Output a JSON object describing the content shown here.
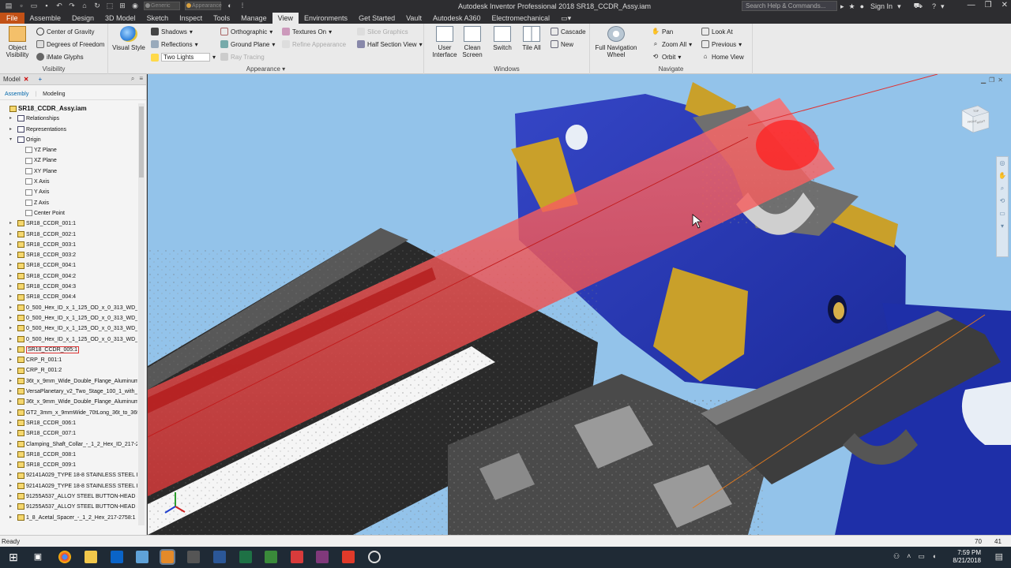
{
  "window": {
    "title": "Autodesk Inventor Professional 2018    SR18_CCDR_Assy.iam",
    "help_search_placeholder": "Search Help & Commands...",
    "sign_in": "Sign In",
    "quick_access_select_1": "Generic",
    "quick_access_select_2": "Appearance"
  },
  "ribbon_tabs": [
    "File",
    "Assemble",
    "Design",
    "3D Model",
    "Sketch",
    "Inspect",
    "Tools",
    "Manage",
    "View",
    "Environments",
    "Get Started",
    "Vault",
    "Autodesk A360",
    "Electromechanical"
  ],
  "active_tab": "View",
  "ribbon": {
    "visibility": {
      "title": "Visibility",
      "object_visibility": "Object Visibility",
      "center_of_gravity": "Center of Gravity",
      "degrees_of_freedom": "Degrees of Freedom",
      "imate_glyphs": "iMate Glyphs"
    },
    "appearance": {
      "title": "Appearance",
      "visual_style": "Visual Style",
      "shadows": "Shadows",
      "reflections": "Reflections",
      "lighting": "Two Lights",
      "orthographic": "Orthographic",
      "ground_plane": "Ground Plane",
      "ray_tracing": "Ray Tracing",
      "textures_on": "Textures On",
      "refine_appearance": "Refine Appearance",
      "slice_graphics": "Slice Graphics",
      "half_section_view": "Half Section View"
    },
    "windows": {
      "title": "Windows",
      "user_interface": "User Interface",
      "clean_screen": "Clean Screen",
      "switch": "Switch",
      "tile_all": "Tile All",
      "cascade": "Cascade",
      "new": "New"
    },
    "navigate": {
      "title": "Navigate",
      "full_navigation_wheel": "Full Navigation Wheel",
      "pan": "Pan",
      "zoom_all": "Zoom All",
      "orbit": "Orbit",
      "look_at": "Look At",
      "previous": "Previous",
      "home_view": "Home View"
    }
  },
  "browser": {
    "tab_label": "Model",
    "sub_tabs": [
      "Assembly",
      "Modeling"
    ],
    "tree": [
      {
        "label": "SR18_CCDR_Assy.iam",
        "level": 0,
        "icon": "assembly",
        "root": true
      },
      {
        "label": "Relationships",
        "level": 1,
        "icon": "folder",
        "expand": "+"
      },
      {
        "label": "Representations",
        "level": 1,
        "icon": "folder",
        "expand": "+"
      },
      {
        "label": "Origin",
        "level": 1,
        "icon": "folder",
        "expand": "-"
      },
      {
        "label": "YZ Plane",
        "level": 2,
        "icon": "plane"
      },
      {
        "label": "XZ Plane",
        "level": 2,
        "icon": "plane"
      },
      {
        "label": "XY Plane",
        "level": 2,
        "icon": "plane"
      },
      {
        "label": "X Axis",
        "level": 2,
        "icon": "axis"
      },
      {
        "label": "Y Axis",
        "level": 2,
        "icon": "axis"
      },
      {
        "label": "Z Axis",
        "level": 2,
        "icon": "axis"
      },
      {
        "label": "Center Point",
        "level": 2,
        "icon": "point"
      },
      {
        "label": "SR18_CCDR_001:1",
        "level": 1,
        "icon": "part",
        "expand": "+"
      },
      {
        "label": "SR18_CCDR_002:1",
        "level": 1,
        "icon": "part",
        "expand": "+"
      },
      {
        "label": "SR18_CCDR_003:1",
        "level": 1,
        "icon": "part",
        "expand": "+"
      },
      {
        "label": "SR18_CCDR_003:2",
        "level": 1,
        "icon": "part",
        "expand": "+"
      },
      {
        "label": "SR18_CCDR_004:1",
        "level": 1,
        "icon": "assembly",
        "expand": "+"
      },
      {
        "label": "SR18_CCDR_004:2",
        "level": 1,
        "icon": "assembly",
        "expand": "+"
      },
      {
        "label": "SR18_CCDR_004:3",
        "level": 1,
        "icon": "assembly",
        "expand": "+"
      },
      {
        "label": "SR18_CCDR_004:4",
        "level": 1,
        "icon": "assembly",
        "expand": "+"
      },
      {
        "label": "0_500_Hex_ID_x_1_125_OD_x_0_313_WD_f",
        "level": 1,
        "icon": "assembly",
        "expand": "+"
      },
      {
        "label": "0_500_Hex_ID_x_1_125_OD_x_0_313_WD_f",
        "level": 1,
        "icon": "assembly",
        "expand": "+"
      },
      {
        "label": "0_500_Hex_ID_x_1_125_OD_x_0_313_WD_f",
        "level": 1,
        "icon": "assembly",
        "expand": "+"
      },
      {
        "label": "0_500_Hex_ID_x_1_125_OD_x_0_313_WD_f",
        "level": 1,
        "icon": "assembly",
        "expand": "+"
      },
      {
        "label": "SR18_CCDR_005:1",
        "level": 1,
        "icon": "assembly",
        "expand": "+",
        "selected": true
      },
      {
        "label": "CRP_R_001:1",
        "level": 1,
        "icon": "assembly",
        "expand": "+"
      },
      {
        "label": "CRP_R_001:2",
        "level": 1,
        "icon": "assembly",
        "expand": "+"
      },
      {
        "label": "36t_x_9mm_Wide_Double_Flange_Aluminum_",
        "level": 1,
        "icon": "assembly",
        "expand": "+"
      },
      {
        "label": "VersaPlanetary_v2_Two_Stage_100_1_with_",
        "level": 1,
        "icon": "assembly",
        "expand": "+"
      },
      {
        "label": "36t_x_9mm_Wide_Double_Flange_Aluminum_",
        "level": 1,
        "icon": "assembly",
        "expand": "+"
      },
      {
        "label": "GT2_3mm_x_9mmWide_70tLong_36t_to_36t",
        "level": 1,
        "icon": "assembly",
        "expand": "+"
      },
      {
        "label": "SR18_CCDR_006:1",
        "level": 1,
        "icon": "part",
        "expand": "+"
      },
      {
        "label": "SR18_CCDR_007:1",
        "level": 1,
        "icon": "part",
        "expand": "+"
      },
      {
        "label": "Clamping_Shaft_Collar_-_1_2_Hex_ID_217-2",
        "level": 1,
        "icon": "part",
        "expand": "+"
      },
      {
        "label": "SR18_CCDR_008:1",
        "level": 1,
        "icon": "assembly",
        "expand": "+"
      },
      {
        "label": "SR18_CCDR_009:1",
        "level": 1,
        "icon": "assembly",
        "expand": "+"
      },
      {
        "label": "92141A029_TYPE 18-8 STAINLESS STEEL FLA",
        "level": 1,
        "icon": "assembly",
        "expand": "+"
      },
      {
        "label": "92141A029_TYPE 18-8 STAINLESS STEEL FLA",
        "level": 1,
        "icon": "assembly",
        "expand": "+"
      },
      {
        "label": "91255A537_ALLOY STEEL BUTTON-HEAD SOC",
        "level": 1,
        "icon": "assembly",
        "expand": "+"
      },
      {
        "label": "91255A537_ALLOY STEEL BUTTON-HEAD SOC",
        "level": 1,
        "icon": "assembly",
        "expand": "+"
      },
      {
        "label": "1_8_Acetal_Spacer_-_1_2_Hex_217-2758:1",
        "level": 1,
        "icon": "assembly",
        "expand": "+"
      }
    ]
  },
  "viewcube": {
    "front": "FRONT",
    "right": "RIGHT",
    "top": "TOP"
  },
  "status_bar": {
    "text": "Ready",
    "count_1": "70",
    "count_2": "41"
  },
  "taskbar": {
    "time": "7:59 PM",
    "date": "8/21/2018"
  },
  "colors": {
    "ribbon_bg": "#eaeaea",
    "titlebar_bg": "#2d2d30",
    "file_tab": "#c25116",
    "viewport_bg": "#93c3ea",
    "part_blue": "#1e2fa8",
    "part_gold": "#c9a02a",
    "shaft_red": "#e84a4a",
    "taskbar_bg": "#1f2a35"
  },
  "icons": [
    "home-icon",
    "save-icon",
    "undo-icon",
    "redo-icon",
    "search-icon",
    "user-icon",
    "cart-icon",
    "help-icon",
    "minimize-icon",
    "maximize-icon",
    "close-icon",
    "windows-start-icon",
    "task-view-icon",
    "chrome-icon",
    "explorer-icon",
    "outlook-icon",
    "inventor-icon",
    "calculator-icon",
    "word-icon",
    "excel-icon",
    "onenote-icon",
    "acrobat-icon"
  ]
}
